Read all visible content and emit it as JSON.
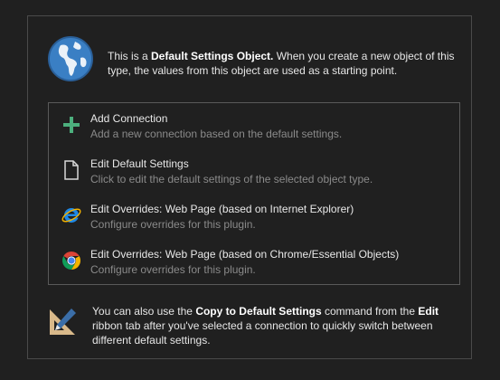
{
  "info": {
    "text_prefix": "This is a ",
    "text_bold": "Default Settings Object.",
    "text_suffix": " When you create a new object of this type, the values from this object are used as a starting point."
  },
  "actions": [
    {
      "title": "Add Connection",
      "desc": "Add a new connection based on the default settings.",
      "icon": "plus-icon"
    },
    {
      "title": "Edit Default Settings",
      "desc": "Click to edit the default settings of the selected object type.",
      "icon": "document-icon"
    },
    {
      "title": "Edit Overrides: Web Page (based on Internet Explorer)",
      "desc": "Configure overrides for this plugin.",
      "icon": "internet-explorer-icon"
    },
    {
      "title": "Edit Overrides: Web Page (based on Chrome/Essential Objects)",
      "desc": "Configure overrides for this plugin.",
      "icon": "chrome-icon"
    }
  ],
  "tip": {
    "t1": "You can also use the ",
    "b1": "Copy to Default Settings",
    "t2": " command from the ",
    "b2": "Edit",
    "t3": " ribbon tab after you've selected a connection to quickly switch between different default settings."
  },
  "colors": {
    "plus": "#4caf7d",
    "globe": "#3a7fc4",
    "ie": "#1e88e5"
  }
}
